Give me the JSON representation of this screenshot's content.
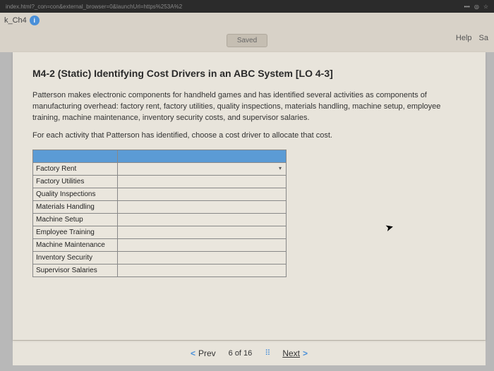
{
  "browser": {
    "url_fragment": "index.html?_con=con&external_browser=0&launchUrl=https%253A%2",
    "tab_label": "k_Ch4"
  },
  "top": {
    "saved_label": "Saved",
    "help_label": "Help",
    "save_label": "Sa"
  },
  "question": {
    "title": "M4-2 (Static) Identifying Cost Drivers in an ABC System [LO 4-3]",
    "body": "Patterson makes electronic components for handheld games and has identified several activities as components of manufacturing overhead: factory rent, factory utilities, quality inspections, materials handling, machine setup, employee training, machine maintenance, inventory security costs, and supervisor salaries.",
    "instruction": "For each activity that Patterson has identified, choose a cost driver to allocate that cost."
  },
  "activities": [
    "Factory Rent",
    "Factory Utilities",
    "Quality Inspections",
    "Materials Handling",
    "Machine Setup",
    "Employee Training",
    "Machine Maintenance",
    "Inventory Security",
    "Supervisor Salaries"
  ],
  "nav": {
    "prev_label": "Prev",
    "position": "6 of 16",
    "next_label": "Next"
  }
}
